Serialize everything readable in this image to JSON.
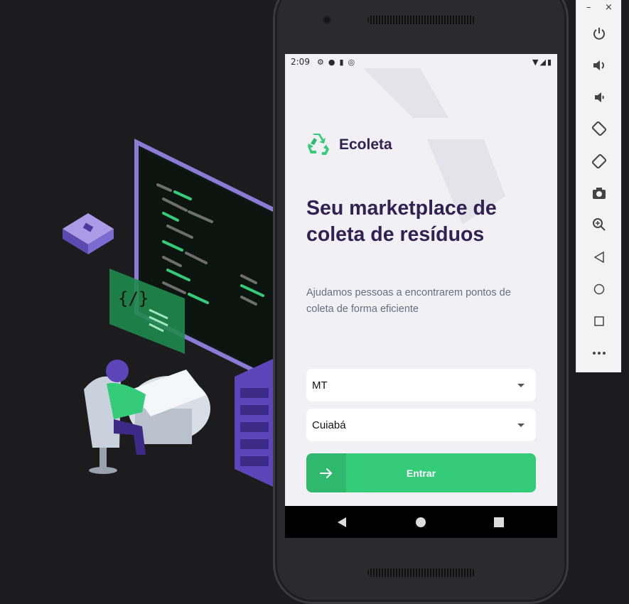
{
  "status_bar": {
    "time": "2:09",
    "left_icons": [
      "settings-icon",
      "android-icon",
      "sd-card-icon",
      "sync-icon"
    ],
    "right_icons": [
      "wifi-icon",
      "signal-icon",
      "battery-icon"
    ]
  },
  "app": {
    "name": "Ecoleta",
    "headline": "Seu marketplace de coleta de resíduos",
    "subtitle": "Ajudamos pessoas a encontrarem pontos de coleta de forma eficiente",
    "uf_select": {
      "value": "MT"
    },
    "city_select": {
      "value": "Cuiabá"
    },
    "enter_button": {
      "label": "Entrar"
    },
    "colors": {
      "primary": "#34cb79",
      "title": "#322153",
      "text": "#6c6c80",
      "background": "#f0f0f5"
    }
  },
  "android_nav": {
    "buttons": [
      "back-icon",
      "home-icon",
      "recents-icon"
    ]
  },
  "emulator_toolbar": {
    "window_controls": [
      "–",
      "×"
    ],
    "buttons": [
      "power-icon",
      "volume-up-icon",
      "volume-down-icon",
      "rotate-left-icon",
      "rotate-right-icon",
      "camera-icon",
      "zoom-icon",
      "back-icon",
      "home-icon",
      "overview-icon",
      "more-icon"
    ]
  }
}
